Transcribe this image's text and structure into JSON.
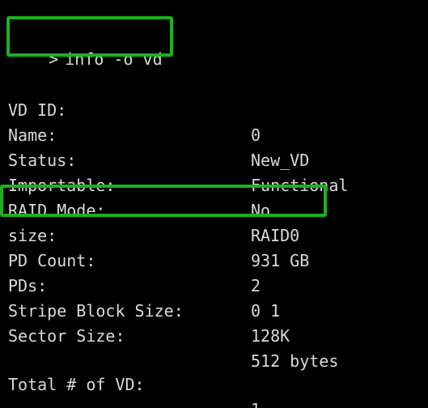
{
  "terminal": {
    "prompt_symbol": ">",
    "command": "info -o vd",
    "fields": [
      {
        "key": "VD ID:",
        "value": "0"
      },
      {
        "key": "Name:",
        "value": "New_VD"
      },
      {
        "key": "Status:",
        "value": "Functional"
      },
      {
        "key": "Importable:",
        "value": "No"
      },
      {
        "key": "RAID Mode:",
        "value": "RAID0"
      },
      {
        "key": "size:",
        "value": "931 GB"
      },
      {
        "key": "PD Count:",
        "value": "2"
      },
      {
        "key": "PDs:",
        "value": "0 1"
      },
      {
        "key": "Stripe Block Size:",
        "value": "128K"
      },
      {
        "key": "Sector Size:",
        "value": "512 bytes"
      }
    ],
    "total": {
      "key": "Total # of VD:",
      "value": "1"
    }
  },
  "colors": {
    "background": "#000000",
    "text": "#d9d9d9",
    "highlight": "#1fb01f"
  }
}
